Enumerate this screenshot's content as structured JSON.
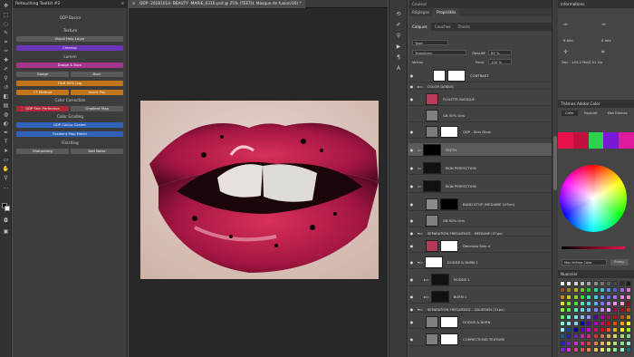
{
  "toolkit": {
    "title": "Retouching Toolkit #2",
    "section_basics": "QDP Basics",
    "section_texture": "Texture",
    "btn_visual_help": "Visual Help Layer",
    "btn_cleanup": "Cleanup",
    "section_lumen": "Lumen",
    "btn_dodge_burn": "Dodge & Burn",
    "btn_dodge": "Dodge",
    "btn_burn": "Burn",
    "btn_db_log": "D&B 50% Log",
    "btn_ct_method": "CT Method",
    "btn_avant_pay": "Avant Pay",
    "section_color_correction": "Color Correction",
    "btn_skin_perfection": "QDP Skin Perfection",
    "btn_gradient_map": "Gradient Map",
    "section_color_grading": "Color Grading",
    "btn_color_grader": "QDP Colour Grader",
    "btn_gradient_map_maker": "Gradient Map Maker",
    "section_finishing": "Finishing",
    "btn_sharpening": "Sharpening",
    "btn_add_noise": "Add Noise"
  },
  "document": {
    "tab_title": "QDP- 20181014- BEAUTY -MARIE_0316.psd @ 25% (TEETH, Masque de fusion/16) *"
  },
  "layers_panel": {
    "tabs": [
      "Couleur",
      "Réglages",
      "Propriétés"
    ],
    "sub_tabs": [
      "Calques",
      "Couches",
      "Tracés"
    ],
    "kind_filter": "Type",
    "blend_mode": "Transform",
    "opacity_label": "Opacité",
    "opacity_value": "85 %",
    "lock_label": "Verrou",
    "fill_label": "Fond",
    "fill_value": "100 %",
    "layers": [
      {
        "name": "CONTRAST",
        "type": "layer"
      },
      {
        "name": "COLOR GENIUS",
        "type": "group"
      },
      {
        "name": "FLOUTTE BASIQUE",
        "type": "layer"
      },
      {
        "name": "GB 50% Gris",
        "type": "layer"
      },
      {
        "name": "QDP - Skin Glow",
        "type": "layer"
      },
      {
        "name": "TEETH",
        "type": "layer"
      },
      {
        "name": "SKIN PERFECTION",
        "type": "layer"
      },
      {
        "name": "SKIN PERFECTION",
        "type": "layer"
      },
      {
        "name": "BAND STOP (MEDIANE 10%m)",
        "type": "layer"
      },
      {
        "name": "GB 50% Gris",
        "type": "layer"
      },
      {
        "name": "SEPARATION FREQUENCE - MEDIANE (37px)",
        "type": "group"
      },
      {
        "name": "Delicious Skin 4",
        "type": "layer"
      },
      {
        "name": "DODGE & BURN 1",
        "type": "group"
      },
      {
        "name": "DODGE 1",
        "type": "layer"
      },
      {
        "name": "BURN 1",
        "type": "layer"
      },
      {
        "name": "SEPARATION FREQUENCE - GAUSSIEN (21px)",
        "type": "group"
      },
      {
        "name": "DODGE & BURN",
        "type": "layer"
      },
      {
        "name": "CORRECTIONS TEXTURE",
        "type": "layer"
      }
    ]
  },
  "info_panel": {
    "title": "Informations",
    "r_label": "8 bits",
    "g_label": "8 bits",
    "doc_label": "Doc : 143,4 Mo/2,01 Go"
  },
  "color_panel": {
    "title": "Thèmes Adobe Color",
    "tabs": [
      "Créer",
      "Explorer",
      "Mes thèmes"
    ],
    "theme_name": "Mon thème Color",
    "save_label": "Enreg.",
    "theme_colors": [
      "#e8124a",
      "#c4103e",
      "#2cd14e",
      "#7a18d8",
      "#e01a9c"
    ]
  },
  "swatches_panel": {
    "title": "Nuancier"
  }
}
